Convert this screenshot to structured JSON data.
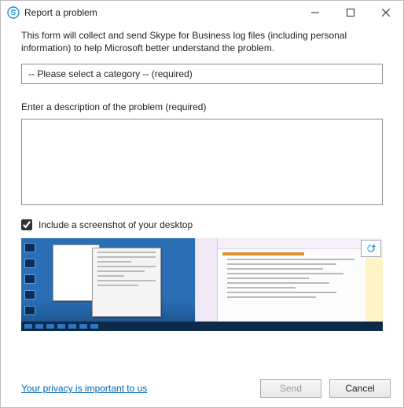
{
  "window": {
    "title": "Report a problem"
  },
  "intro": "This form will collect and send Skype for Business log files (including personal information) to help Microsoft better understand the problem.",
  "category": {
    "placeholder": "-- Please select a category -- (required)"
  },
  "description": {
    "label": "Enter a description of the problem (required)",
    "value": ""
  },
  "screenshot": {
    "label": "Include a screenshot of your desktop",
    "checked": true
  },
  "footer": {
    "privacy": "Your privacy is important to us",
    "send": "Send",
    "cancel": "Cancel"
  }
}
